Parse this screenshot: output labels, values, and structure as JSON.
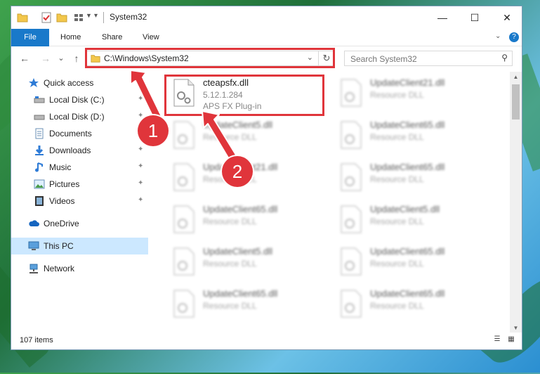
{
  "window": {
    "title": "System32",
    "controls": {
      "minimize": "—",
      "maximize": "☐",
      "close": "✕"
    }
  },
  "ribbon": {
    "tabs": [
      "File",
      "Home",
      "Share",
      "View"
    ],
    "help": "?"
  },
  "nav": {
    "back": "←",
    "forward": "→",
    "recent": "⌄",
    "up": "↑",
    "address": "C:\\Windows\\System32",
    "address_dropdown": "⌄",
    "refresh": "↻",
    "search_placeholder": "Search System32"
  },
  "sidebar": {
    "items": [
      {
        "label": "Quick access",
        "icon": "star-icon",
        "pinned": false
      },
      {
        "label": "Local Disk (C:)",
        "icon": "drive-icon",
        "pinned": true
      },
      {
        "label": "Local Disk (D:)",
        "icon": "drive-icon",
        "pinned": true
      },
      {
        "label": "Documents",
        "icon": "documents-icon",
        "pinned": true
      },
      {
        "label": "Downloads",
        "icon": "download-icon",
        "pinned": true
      },
      {
        "label": "Music",
        "icon": "music-icon",
        "pinned": true
      },
      {
        "label": "Pictures",
        "icon": "pictures-icon",
        "pinned": true
      },
      {
        "label": "Videos",
        "icon": "videos-icon",
        "pinned": true
      },
      {
        "label": "OneDrive",
        "icon": "cloud-icon",
        "pinned": false
      },
      {
        "label": "This PC",
        "icon": "computer-icon",
        "pinned": false,
        "selected": true
      },
      {
        "label": "Network",
        "icon": "network-icon",
        "pinned": false
      }
    ],
    "pin_glyph": "📌"
  },
  "files": [
    {
      "name": "cteapsfx.dll",
      "line2": "5.12.1.284",
      "line3": "APS FX Plug-in",
      "highlight": true
    },
    {
      "name": "UpdateClient21.dll",
      "line2": "Resource DLL"
    },
    {
      "name": "UpdateClient5.dll",
      "line2": "Resource DLL"
    },
    {
      "name": "UpdateClient65.dll",
      "line2": "Resource DLL"
    },
    {
      "name": "UpdateClient21.dll",
      "line2": "Resource DLL"
    },
    {
      "name": "UpdateClient65.dll",
      "line2": "Resource DLL"
    },
    {
      "name": "UpdateClient65.dll",
      "line2": "Resource DLL"
    },
    {
      "name": "UpdateClient5.dll",
      "line2": "Resource DLL"
    },
    {
      "name": "UpdateClient5.dll",
      "line2": "Resource DLL"
    },
    {
      "name": "UpdateClient65.dll",
      "line2": "Resource DLL"
    },
    {
      "name": "UpdateClient65.dll",
      "line2": "Resource DLL"
    },
    {
      "name": "UpdateClient65.dll",
      "line2": "Resource DLL"
    }
  ],
  "status": {
    "count": "107 items"
  },
  "annotations": [
    {
      "number": "1"
    },
    {
      "number": "2"
    }
  ],
  "colors": {
    "accent": "#1979ca",
    "annotation_red": "#e0353b",
    "selection": "#cce8ff"
  }
}
